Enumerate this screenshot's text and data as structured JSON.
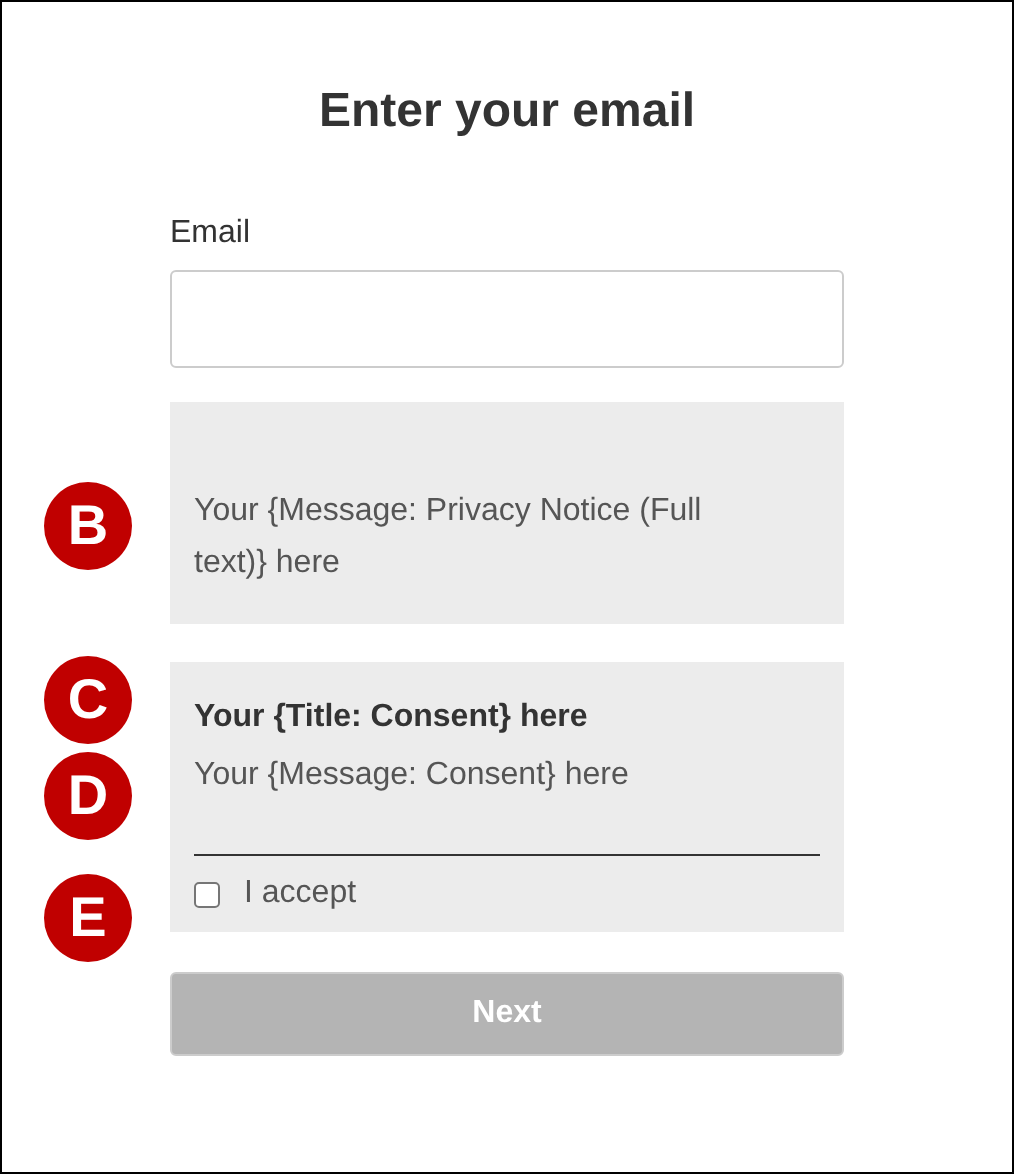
{
  "title": "Enter your email",
  "email": {
    "label": "Email"
  },
  "privacy": {
    "message": "Your {Message: Privacy Notice (Full text)} here",
    "marker": "B"
  },
  "consent": {
    "title": "Your {Title: Consent} here",
    "title_marker": "C",
    "message": "Your {Message: Consent} here",
    "message_marker": "D",
    "checkbox": {
      "label": "I accept",
      "checked": false,
      "marker": "E"
    }
  },
  "next_button": {
    "label": "Next",
    "disabled": true
  }
}
